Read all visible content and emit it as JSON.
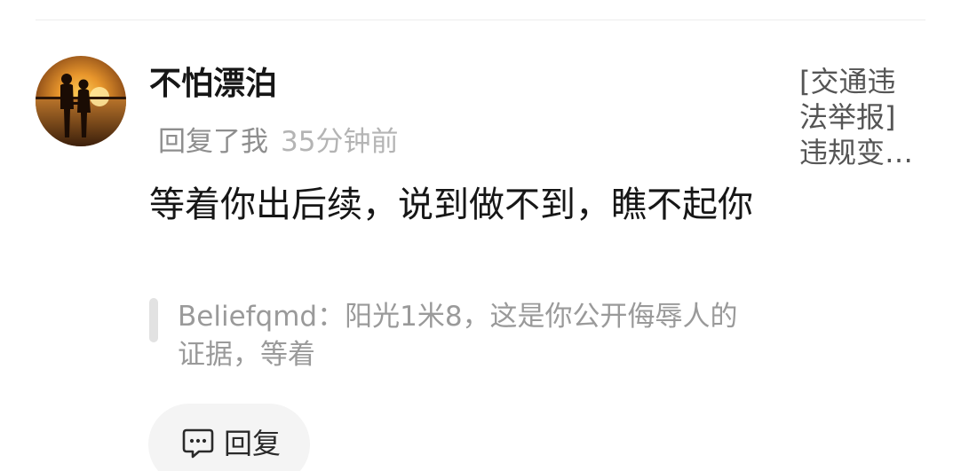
{
  "comment": {
    "username": "不怕漂泊",
    "reply_to": "回复了我",
    "time": "35分钟前",
    "text": "等着你出后续，说到做不到，瞧不起你",
    "quote": "Beliefqmd：阳光1米8，这是你公开侮辱人的证据，等着",
    "reply_button_label": "回复"
  },
  "side_link": {
    "lines": [
      "[交通违",
      "法举报]",
      "违规变…"
    ]
  },
  "icons": {
    "reply": "comment-bubble-icon"
  },
  "colors": {
    "username": "#161616",
    "muted": "#8e8e8e",
    "time": "#b4b4b4",
    "quote": "#9a9a9a",
    "button_bg": "#f4f4f4"
  }
}
